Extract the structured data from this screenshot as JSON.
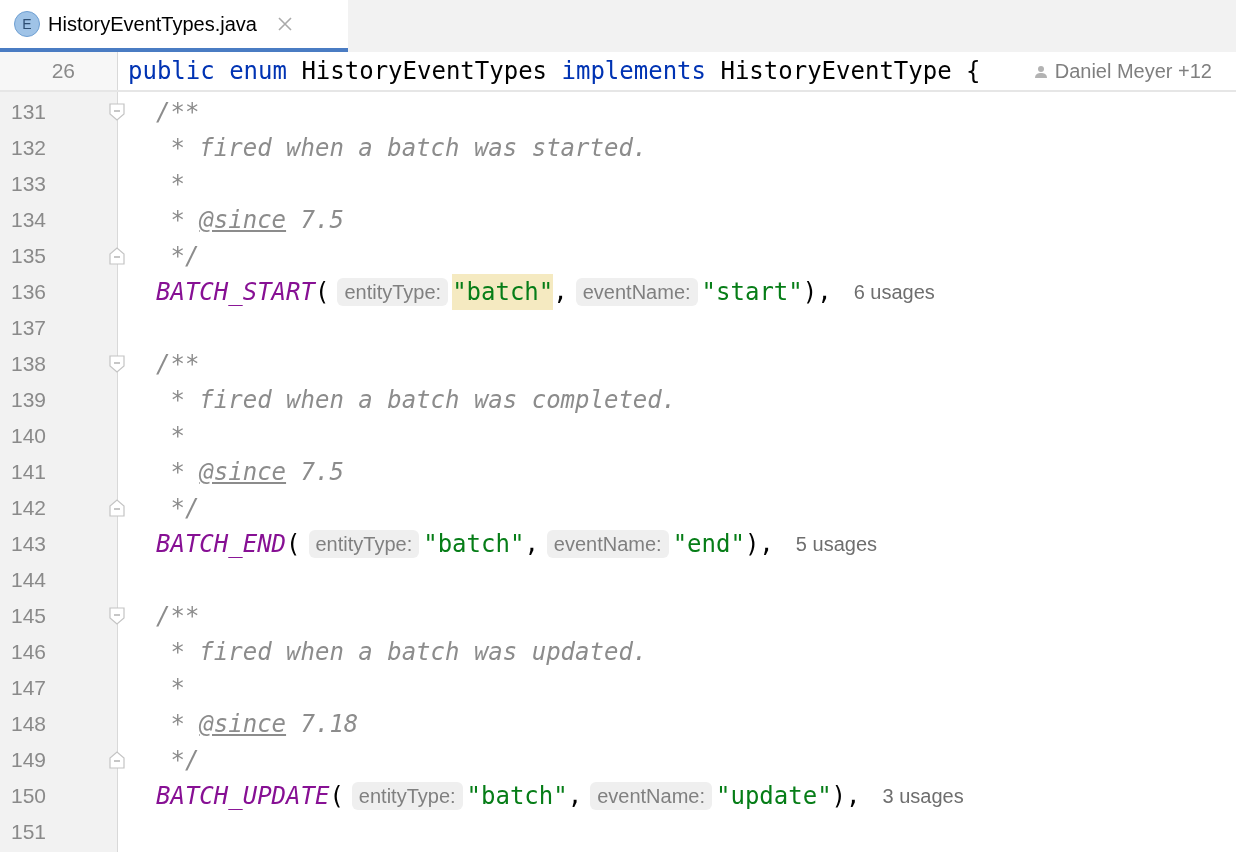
{
  "tabs": [
    {
      "label": "HistoryEventTypes.java",
      "icon": "E",
      "selected": true
    }
  ],
  "sticky_header": {
    "number": "26",
    "tokens": [
      {
        "kind": "keyword",
        "text": "public "
      },
      {
        "kind": "keyword",
        "text": "enum "
      },
      {
        "kind": "plain",
        "text": "HistoryEventTypes "
      },
      {
        "kind": "keyword",
        "text": "implements "
      },
      {
        "kind": "plain",
        "text": "HistoryEventType {"
      }
    ],
    "author": "Daniel Meyer +12"
  },
  "lines": [
    {
      "number": "131",
      "fold_start": true,
      "fold_end": false,
      "kind": "comment",
      "segments": [
        {
          "kind": "plain",
          "text": "/**"
        }
      ]
    },
    {
      "number": "132",
      "fold_start": false,
      "fold_end": false,
      "kind": "comment",
      "segments": [
        {
          "kind": "plain",
          "text": " * fired when a batch was started."
        }
      ]
    },
    {
      "number": "133",
      "fold_start": false,
      "fold_end": false,
      "kind": "comment",
      "segments": [
        {
          "kind": "plain",
          "text": " *"
        }
      ]
    },
    {
      "number": "134",
      "fold_start": false,
      "fold_end": false,
      "kind": "comment",
      "segments": [
        {
          "kind": "plain",
          "text": " * "
        },
        {
          "kind": "tag",
          "text": "@since"
        },
        {
          "kind": "plain",
          "text": " 7.5"
        }
      ]
    },
    {
      "number": "135",
      "fold_start": false,
      "fold_end": true,
      "kind": "comment",
      "segments": [
        {
          "kind": "plain",
          "text": " */"
        }
      ]
    },
    {
      "number": "136",
      "fold_start": false,
      "fold_end": false,
      "kind": "code",
      "tokens": [
        {
          "kind": "constant",
          "text": "BATCH_START"
        },
        {
          "kind": "punct",
          "text": "("
        },
        {
          "kind": "hint",
          "text": "entityType:"
        },
        {
          "kind": "string",
          "text": "\"batch\"",
          "highlighted": true
        },
        {
          "kind": "punct",
          "text": ","
        },
        {
          "kind": "hint",
          "text": "eventName:"
        },
        {
          "kind": "string",
          "text": "\"start\"",
          "highlighted": false
        },
        {
          "kind": "punct",
          "text": "),"
        },
        {
          "kind": "usages",
          "text": "6 usages"
        }
      ]
    },
    {
      "number": "137",
      "fold_start": false,
      "fold_end": false,
      "kind": "blank"
    },
    {
      "number": "138",
      "fold_start": true,
      "fold_end": false,
      "kind": "comment",
      "segments": [
        {
          "kind": "plain",
          "text": "/**"
        }
      ]
    },
    {
      "number": "139",
      "fold_start": false,
      "fold_end": false,
      "kind": "comment",
      "segments": [
        {
          "kind": "plain",
          "text": " * fired when a batch was completed."
        }
      ]
    },
    {
      "number": "140",
      "fold_start": false,
      "fold_end": false,
      "kind": "comment",
      "segments": [
        {
          "kind": "plain",
          "text": " *"
        }
      ]
    },
    {
      "number": "141",
      "fold_start": false,
      "fold_end": false,
      "kind": "comment",
      "segments": [
        {
          "kind": "plain",
          "text": " * "
        },
        {
          "kind": "tag",
          "text": "@since"
        },
        {
          "kind": "plain",
          "text": " 7.5"
        }
      ]
    },
    {
      "number": "142",
      "fold_start": false,
      "fold_end": true,
      "kind": "comment",
      "segments": [
        {
          "kind": "plain",
          "text": " */"
        }
      ]
    },
    {
      "number": "143",
      "fold_start": false,
      "fold_end": false,
      "kind": "code",
      "tokens": [
        {
          "kind": "constant",
          "text": "BATCH_END"
        },
        {
          "kind": "punct",
          "text": "("
        },
        {
          "kind": "hint",
          "text": "entityType:"
        },
        {
          "kind": "string",
          "text": "\"batch\"",
          "highlighted": false
        },
        {
          "kind": "punct",
          "text": ","
        },
        {
          "kind": "hint",
          "text": "eventName:"
        },
        {
          "kind": "string",
          "text": "\"end\"",
          "highlighted": false
        },
        {
          "kind": "punct",
          "text": "),"
        },
        {
          "kind": "usages",
          "text": "5 usages"
        }
      ]
    },
    {
      "number": "144",
      "fold_start": false,
      "fold_end": false,
      "kind": "blank"
    },
    {
      "number": "145",
      "fold_start": true,
      "fold_end": false,
      "kind": "comment",
      "segments": [
        {
          "kind": "plain",
          "text": "/**"
        }
      ]
    },
    {
      "number": "146",
      "fold_start": false,
      "fold_end": false,
      "kind": "comment",
      "segments": [
        {
          "kind": "plain",
          "text": " * fired when a batch was updated."
        }
      ]
    },
    {
      "number": "147",
      "fold_start": false,
      "fold_end": false,
      "kind": "comment",
      "segments": [
        {
          "kind": "plain",
          "text": " *"
        }
      ]
    },
    {
      "number": "148",
      "fold_start": false,
      "fold_end": false,
      "kind": "comment",
      "segments": [
        {
          "kind": "plain",
          "text": " * "
        },
        {
          "kind": "tag",
          "text": "@since"
        },
        {
          "kind": "plain",
          "text": " 7.18"
        }
      ]
    },
    {
      "number": "149",
      "fold_start": false,
      "fold_end": true,
      "kind": "comment",
      "segments": [
        {
          "kind": "plain",
          "text": " */"
        }
      ]
    },
    {
      "number": "150",
      "fold_start": false,
      "fold_end": false,
      "kind": "code",
      "tokens": [
        {
          "kind": "constant",
          "text": "BATCH_UPDATE"
        },
        {
          "kind": "punct",
          "text": "("
        },
        {
          "kind": "hint",
          "text": "entityType:"
        },
        {
          "kind": "string",
          "text": "\"batch\"",
          "highlighted": false
        },
        {
          "kind": "punct",
          "text": ","
        },
        {
          "kind": "hint",
          "text": "eventName:"
        },
        {
          "kind": "string",
          "text": "\"update\"",
          "highlighted": false
        },
        {
          "kind": "punct",
          "text": "),"
        },
        {
          "kind": "usages",
          "text": "3 usages"
        }
      ]
    },
    {
      "number": "151",
      "fold_start": false,
      "fold_end": false,
      "kind": "blank"
    }
  ]
}
